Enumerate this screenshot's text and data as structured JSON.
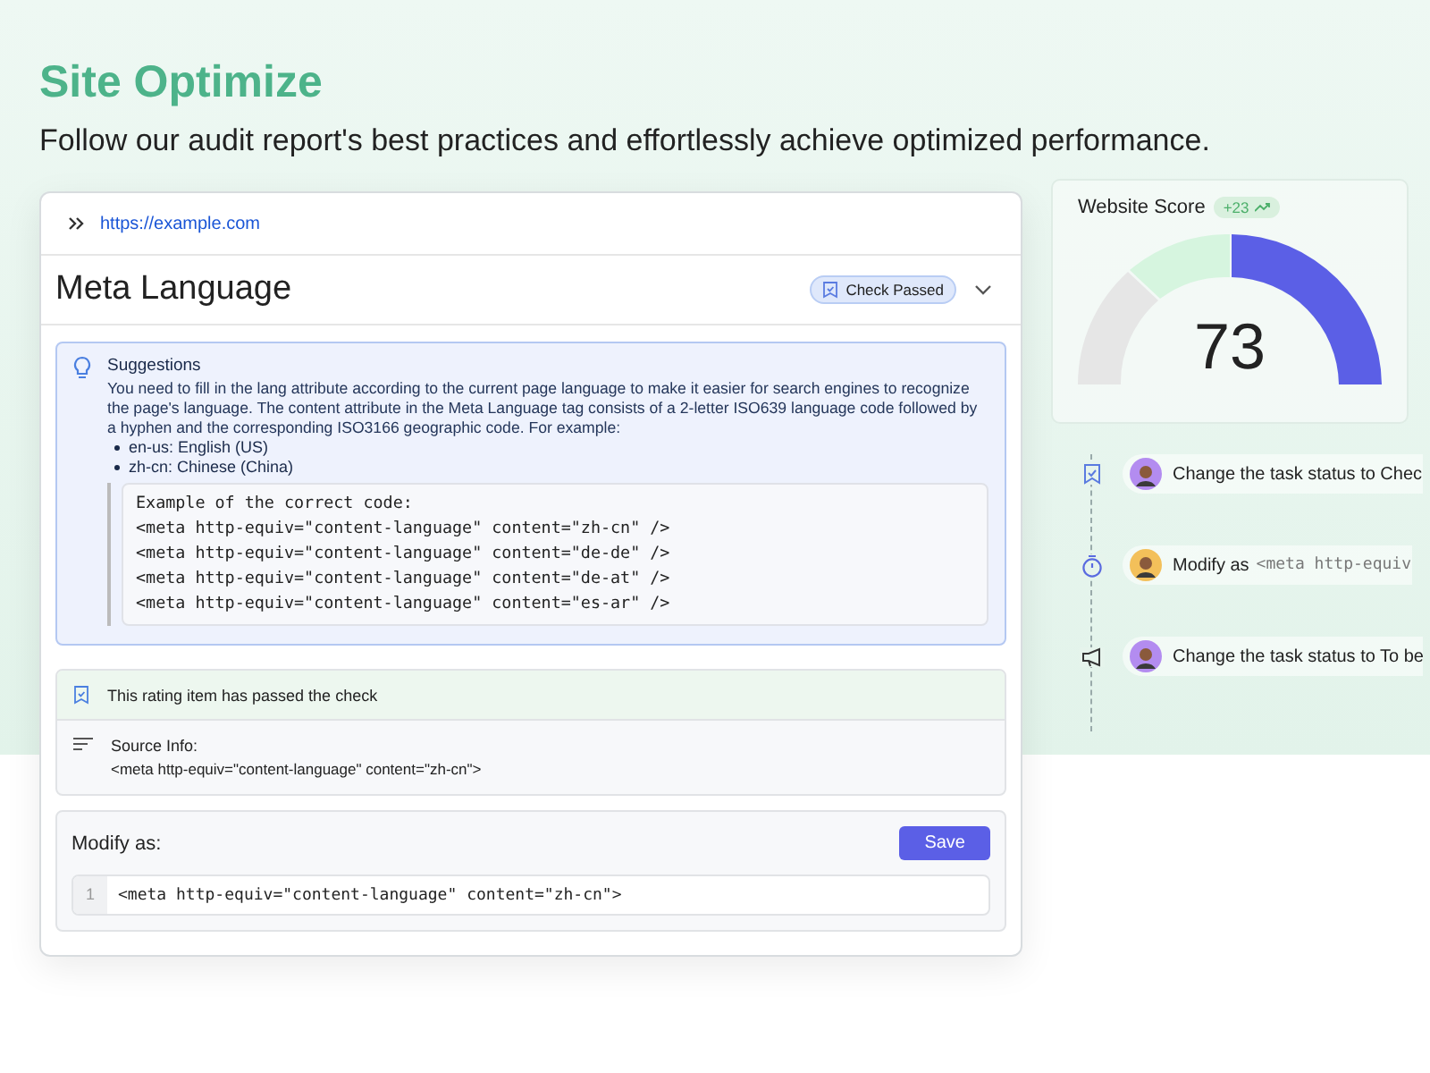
{
  "header": {
    "title": "Site Optimize",
    "subtitle": "Follow our audit report's best practices and effortlessly achieve optimized performance."
  },
  "card": {
    "url": "https://example.com",
    "title": "Meta Language",
    "badge": "Check Passed",
    "expanded": true,
    "suggestion": {
      "heading": "Suggestions",
      "text": "You need to fill in the lang attribute according to the current page language to make it easier for search engines to recognize the page's language. The content attribute in the Meta Language tag consists of a 2-letter ISO639 language code followed by a hyphen and the corresponding ISO3166 geographic code. For example:",
      "bullets": [
        "en-us: English (US)",
        "zh-cn: Chinese (China)"
      ],
      "code": [
        "Example of the correct code:",
        "<meta http-equiv=\"content-language\" content=\"zh-cn\" />",
        "<meta http-equiv=\"content-language\" content=\"de-de\" />",
        "<meta http-equiv=\"content-language\" content=\"de-at\" />",
        "<meta http-equiv=\"content-language\" content=\"es-ar\" />"
      ]
    },
    "passed": "This rating item has passed the check",
    "source": {
      "label": "Source Info:",
      "value": "<meta http-equiv=\"content-language\" content=\"zh-cn\">"
    },
    "modify": {
      "label": "Modify as:",
      "button": "Save",
      "line_number": "1",
      "value": "<meta http-equiv=\"content-language\" content=\"zh-cn\">"
    }
  },
  "score": {
    "title": "Website Score",
    "delta": "+23",
    "value": "73"
  },
  "timeline": [
    {
      "kind": "check",
      "color": "#b38cf0",
      "text": "Change the task status to Chec"
    },
    {
      "kind": "timer",
      "color": "#f3c05a",
      "text": "Modify as",
      "code": "<meta http-equiv"
    },
    {
      "kind": "megaphone",
      "color": "#b38cf0",
      "text": "Change the task status to To be"
    }
  ]
}
